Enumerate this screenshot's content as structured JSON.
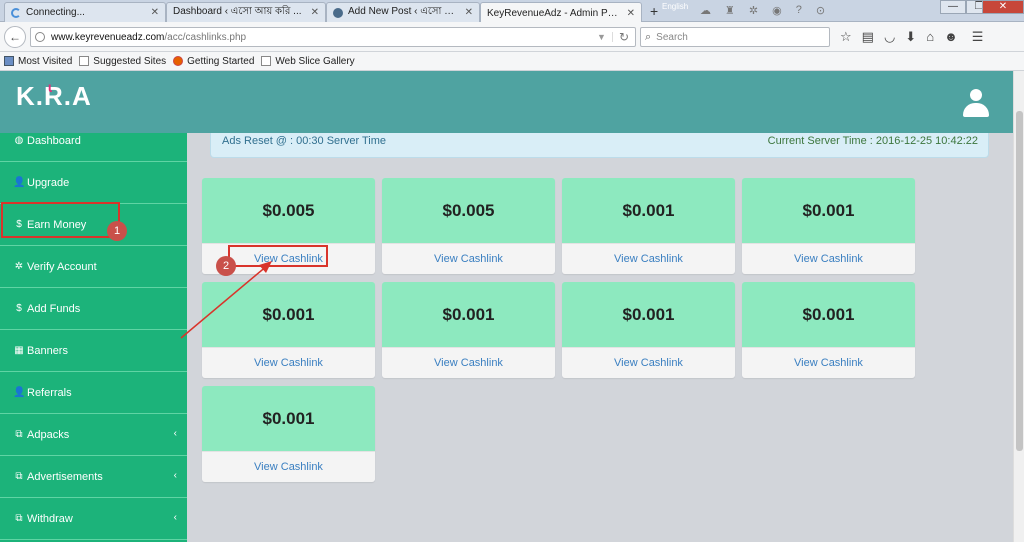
{
  "browser": {
    "tabs": [
      {
        "label": "Connecting...",
        "icon": "loading-spinner"
      },
      {
        "label": "Dashboard ‹ এসো আয় করি ...",
        "icon": "wordpress-icon"
      },
      {
        "label": "Add New Post ‹ এসো আয়...",
        "icon": "wordpress-icon"
      },
      {
        "label": "KeyRevenueAdz - Admin Panel",
        "icon": "none"
      }
    ],
    "lang": "English",
    "url_host": "www.keyrevenueadz.com",
    "url_path": "/acc/cashlinks.php",
    "search_placeholder": "Search",
    "bookmarks": [
      "Most Visited",
      "Suggested Sites",
      "Getting Started",
      "Web Slice Gallery"
    ]
  },
  "app": {
    "logo": "K.R.A",
    "logo_parts": [
      "K.",
      "R",
      ".A"
    ],
    "header_color": "#4fa3a1",
    "sidebar_color": "#1cb37a"
  },
  "sidebar": {
    "items": [
      {
        "label": "Dashboard",
        "icon": "dashboard-icon",
        "glyph": "◍",
        "caret": false
      },
      {
        "label": "Upgrade",
        "icon": "user-icon",
        "glyph": "👤",
        "caret": false
      },
      {
        "label": "Earn Money",
        "icon": "dollar-icon",
        "glyph": "$",
        "caret": false
      },
      {
        "label": "Verify Account",
        "icon": "gear-icon",
        "glyph": "✲",
        "caret": false
      },
      {
        "label": "Add Funds",
        "icon": "dollar-icon",
        "glyph": "$",
        "caret": false
      },
      {
        "label": "Banners",
        "icon": "table-icon",
        "glyph": "▦",
        "caret": false
      },
      {
        "label": "Referrals",
        "icon": "user-icon",
        "glyph": "👤",
        "caret": false
      },
      {
        "label": "Adpacks",
        "icon": "copy-icon",
        "glyph": "⧉",
        "caret": true
      },
      {
        "label": "Advertisements",
        "icon": "copy-icon",
        "glyph": "⧉",
        "caret": true
      },
      {
        "label": "Withdraw",
        "icon": "copy-icon",
        "glyph": "⧉",
        "caret": true
      }
    ]
  },
  "info": {
    "ads_reset": "Ads Reset @ : 00:30 Server Time",
    "server_time": "Current Server Time : 2016-12-25 10:42:22"
  },
  "cashlinks": [
    {
      "amount": "$0.005",
      "link": "View Cashlink"
    },
    {
      "amount": "$0.005",
      "link": "View Cashlink"
    },
    {
      "amount": "$0.001",
      "link": "View Cashlink"
    },
    {
      "amount": "$0.001",
      "link": "View Cashlink"
    },
    {
      "amount": "$0.001",
      "link": "View Cashlink"
    },
    {
      "amount": "$0.001",
      "link": "View Cashlink"
    },
    {
      "amount": "$0.001",
      "link": "View Cashlink"
    },
    {
      "amount": "$0.001",
      "link": "View Cashlink"
    },
    {
      "amount": "$0.001",
      "link": "View Cashlink"
    }
  ],
  "annotations": {
    "step1": "1",
    "step2": "2",
    "color": "#d9342b"
  }
}
